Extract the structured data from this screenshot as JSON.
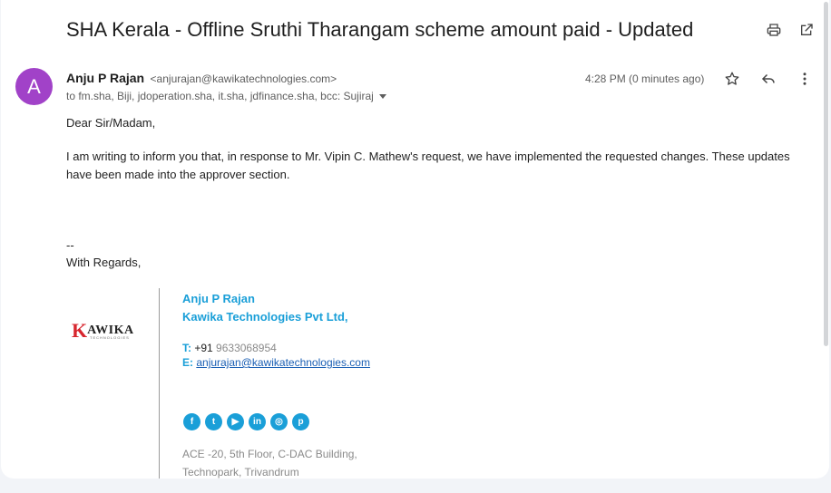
{
  "email": {
    "subject": "SHA Kerala - Offline Sruthi Tharangam scheme amount paid - Updated",
    "sender": {
      "avatar_letter": "A",
      "avatar_color": "#a142c8",
      "name": "Anju P Rajan",
      "email": "<anjurajan@kawikatechnologies.com>"
    },
    "recipients": "to fm.sha, Biji, jdoperation.sha, it.sha, jdfinance.sha, bcc: Sujiraj",
    "time": "4:28 PM (0 minutes ago)",
    "body": {
      "greeting": "Dear Sir/Madam,",
      "paragraph": "I am writing to inform you that, in response to Mr. Vipin C. Mathew's request, we have implemented the requested changes. These updates have been made into the approver section.",
      "sig_separator": "--",
      "closing": "With Regards,"
    }
  },
  "signature": {
    "logo": {
      "letter": "K",
      "text": "AWIKA",
      "sub": "TECHNOLOGIES"
    },
    "name": "Anju P Rajan",
    "company": "Kawika Technologies Pvt Ltd,",
    "phone_label": "T:",
    "phone_prefix": "+91",
    "phone": "9633068954",
    "email_label": "E:",
    "email": "anjurajan@kawikatechnologies.com",
    "social": [
      {
        "glyph": "f",
        "icon": "facebook-icon"
      },
      {
        "glyph": "t",
        "icon": "twitter-icon"
      },
      {
        "glyph": "▶",
        "icon": "youtube-icon"
      },
      {
        "glyph": "in",
        "icon": "linkedin-icon"
      },
      {
        "glyph": "◎",
        "icon": "instagram-icon"
      },
      {
        "glyph": "p",
        "icon": "pinterest-icon"
      }
    ],
    "address_line1": "ACE -20, 5th Floor,  C-DAC Building,",
    "address_line2": "Technopark, Trivandrum"
  },
  "colors": {
    "accent": "#1a9fd8",
    "link": "#1a5fb4"
  }
}
